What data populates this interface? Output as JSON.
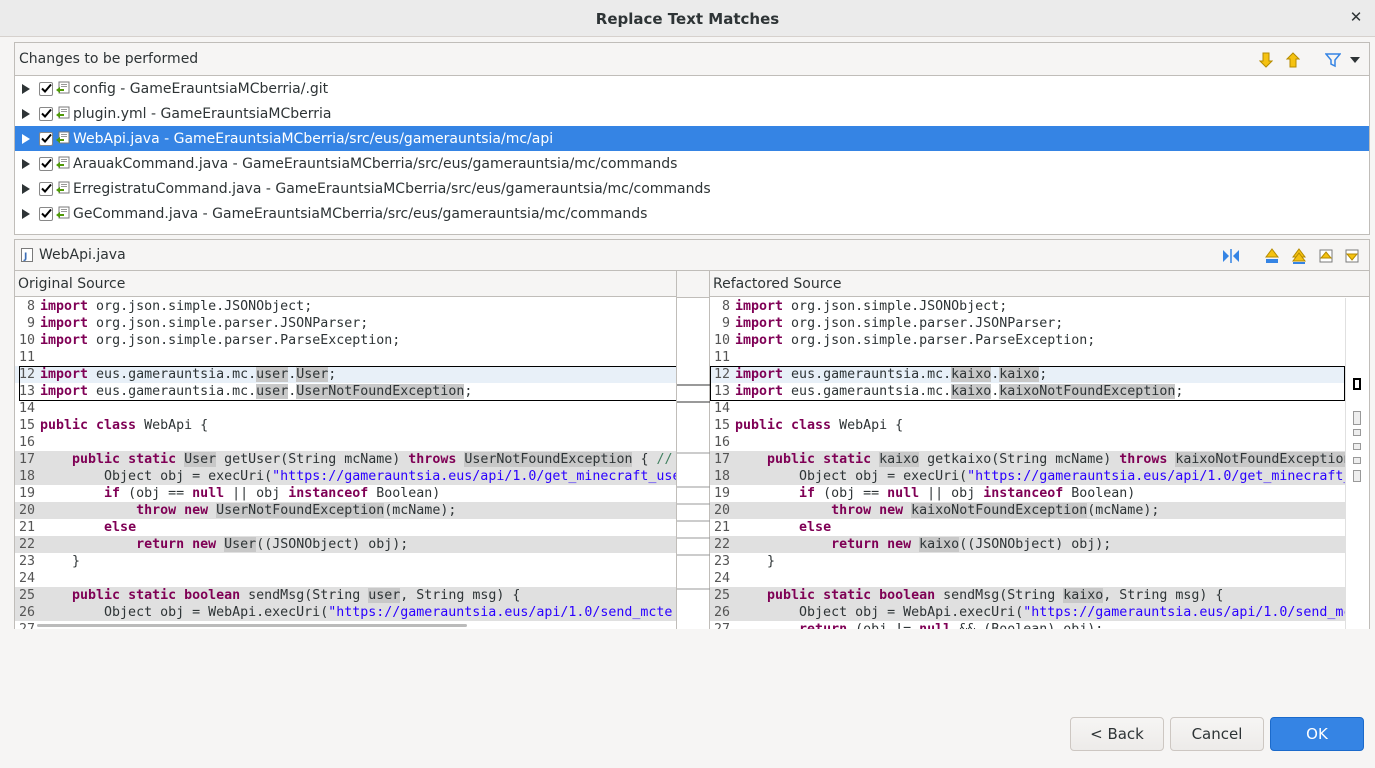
{
  "dialog": {
    "title": "Replace Text Matches",
    "close_glyph": "✕"
  },
  "changes": {
    "header": "Changes to be performed",
    "items": [
      {
        "label": "config - GameErauntsiaMCberria/.git"
      },
      {
        "label": "plugin.yml - GameErauntsiaMCberria"
      },
      {
        "label": "WebApi.java - GameErauntsiaMCberria/src/eus/gamerauntsia/mc/api"
      },
      {
        "label": "ArauakCommand.java - GameErauntsiaMCberria/src/eus/gamerauntsia/mc/commands"
      },
      {
        "label": "ErregistratuCommand.java - GameErauntsiaMCberria/src/eus/gamerauntsia/mc/commands"
      },
      {
        "label": "GeCommand.java - GameErauntsiaMCberria/src/eus/gamerauntsia/mc/commands"
      }
    ],
    "selected_index": 2
  },
  "preview": {
    "file": "WebApi.java",
    "original_title": "Original Source",
    "refactored_title": "Refactored Source"
  },
  "colors": {
    "accent": "#3584e4",
    "keyword": "#7f0055",
    "string": "#2a00ff"
  },
  "buttons": {
    "back": "< Back",
    "cancel": "Cancel",
    "ok": "OK"
  }
}
